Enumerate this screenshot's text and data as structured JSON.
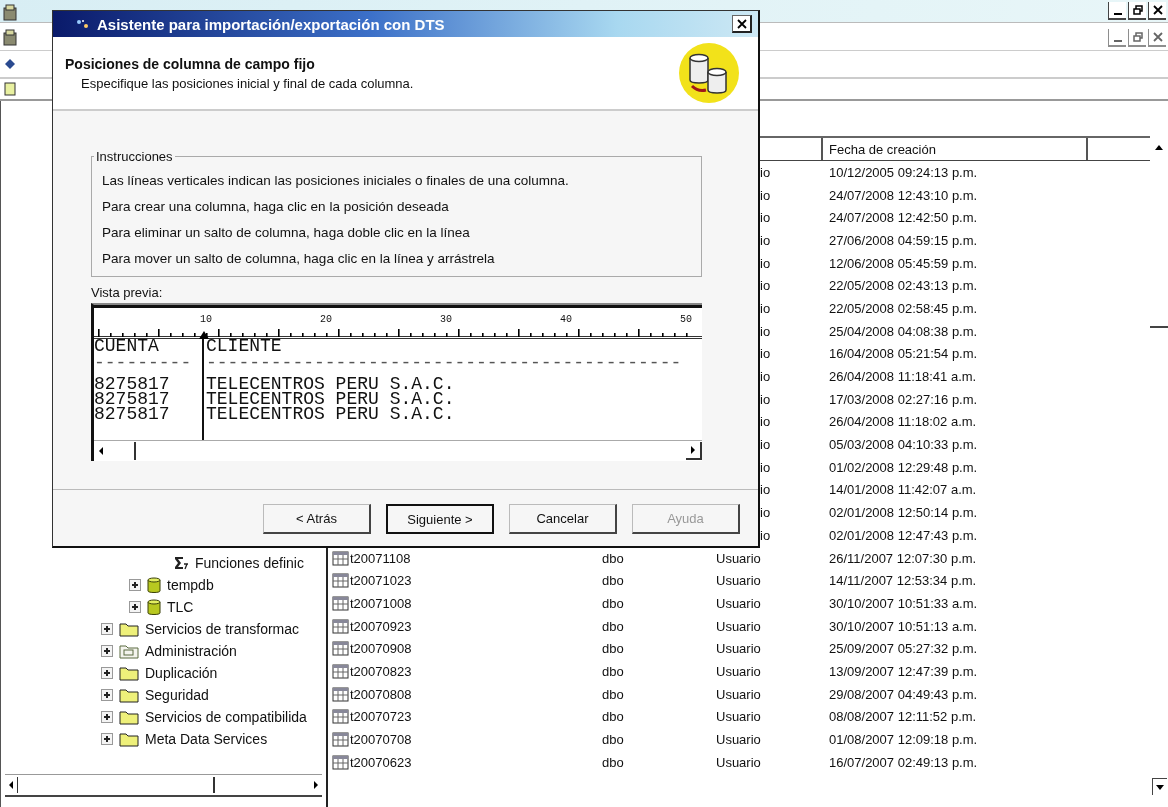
{
  "dialog": {
    "title": "Asistente para importación/exportación con DTS",
    "heading": "Posiciones de columna de campo fijo",
    "subheading": "Especifique las posiciones inicial y final de cada columna.",
    "instructions": {
      "legend": "Instrucciones",
      "lines": [
        "Las líneas verticales indican las posiciones iniciales o finales de una columna.",
        "Para crear una columna, haga clic en la posición deseada",
        "Para eliminar un salto de columna, haga doble clic en la línea",
        "Para mover un salto de columna, haga clic en la línea y arrástrela"
      ]
    },
    "preview": {
      "label": "Vista previa:",
      "ruler": [
        "10",
        "20",
        "30",
        "40",
        "50"
      ],
      "columns": [
        {
          "header": "CUENTA",
          "rule": "---------",
          "values": [
            "8275817",
            "8275817",
            "8275817"
          ]
        },
        {
          "header": "CLIENTE",
          "rule": "--------------------------------------------",
          "values": [
            "TELECENTROS PERU S.A.C.",
            "TELECENTROS PERU S.A.C.",
            "TELECENTROS PERU S.A.C."
          ]
        }
      ]
    },
    "buttons": [
      {
        "label": "< Atrás",
        "default": false,
        "disabled": false
      },
      {
        "label": "Siguiente >",
        "default": true,
        "disabled": false
      },
      {
        "label": "Cancelar",
        "default": false,
        "disabled": false
      },
      {
        "label": "Ayuda",
        "default": false,
        "disabled": true
      }
    ]
  },
  "tree": {
    "items": [
      {
        "children": [
          {
            "children": [
              {
                "label": "Funciones definic",
                "kind": "functions"
              }
            ]
          },
          {
            "label": "tempdb",
            "kind": "database",
            "expanded": false
          },
          {
            "label": "TLC",
            "kind": "database",
            "expanded": false
          }
        ]
      },
      {
        "label": "Servicios de transformac",
        "kind": "folder",
        "expanded": false
      },
      {
        "label": "Administración",
        "kind": "admin-folder",
        "expanded": false
      },
      {
        "label": "Duplicación",
        "kind": "folder",
        "expanded": false
      },
      {
        "label": "Seguridad",
        "kind": "folder",
        "expanded": false
      },
      {
        "label": "Servicios de compatibilida",
        "kind": "folder",
        "expanded": false
      },
      {
        "label": "Meta Data Services",
        "kind": "folder",
        "expanded": false
      }
    ]
  },
  "list": {
    "created_header": "Fecha de creación",
    "rows": [
      {
        "type": "io",
        "created": "10/12/2005 09:24:13 p.m."
      },
      {
        "type": "io",
        "created": "24/07/2008 12:43:10 p.m."
      },
      {
        "type": "io",
        "created": "24/07/2008 12:42:50 p.m."
      },
      {
        "type": "io",
        "created": "27/06/2008 04:59:15 p.m."
      },
      {
        "type": "io",
        "created": "12/06/2008 05:45:59 p.m."
      },
      {
        "type": "io",
        "created": "22/05/2008 02:43:13 p.m."
      },
      {
        "type": "io",
        "created": "22/05/2008 02:58:45 p.m."
      },
      {
        "type": "io",
        "created": "25/04/2008 04:08:38 p.m."
      },
      {
        "type": "io",
        "created": "16/04/2008 05:21:54 p.m."
      },
      {
        "type": "io",
        "created": "26/04/2008 11:18:41 a.m."
      },
      {
        "type": "io",
        "created": "17/03/2008 02:27:16 p.m."
      },
      {
        "type": "io",
        "created": "26/04/2008 11:18:02 a.m."
      },
      {
        "type": "io",
        "created": "05/03/2008 04:10:33 p.m."
      },
      {
        "type": "io",
        "created": "01/02/2008 12:29:48 p.m."
      },
      {
        "type": "io",
        "created": "14/01/2008 11:42:07 a.m."
      },
      {
        "type": "io",
        "created": "02/01/2008 12:50:14 p.m."
      },
      {
        "type": "io",
        "created": "02/01/2008 12:47:43 p.m."
      },
      {
        "name": "t20071108",
        "owner": "dbo",
        "type": "Usuario",
        "created": "26/11/2007 12:07:30 p.m."
      },
      {
        "name": "t20071023",
        "owner": "dbo",
        "type": "Usuario",
        "created": "14/11/2007 12:53:34 p.m."
      },
      {
        "name": "t20071008",
        "owner": "dbo",
        "type": "Usuario",
        "created": "30/10/2007 10:51:33 a.m."
      },
      {
        "name": "t20070923",
        "owner": "dbo",
        "type": "Usuario",
        "created": "30/10/2007 10:51:13 a.m."
      },
      {
        "name": "t20070908",
        "owner": "dbo",
        "type": "Usuario",
        "created": "25/09/2007 05:27:32 p.m."
      },
      {
        "name": "t20070823",
        "owner": "dbo",
        "type": "Usuario",
        "created": "13/09/2007 12:47:39 p.m."
      },
      {
        "name": "t20070808",
        "owner": "dbo",
        "type": "Usuario",
        "created": "29/08/2007 04:49:43 p.m."
      },
      {
        "name": "t20070723",
        "owner": "dbo",
        "type": "Usuario",
        "created": "08/08/2007 12:11:52 p.m."
      },
      {
        "name": "t20070708",
        "owner": "dbo",
        "type": "Usuario",
        "created": "01/08/2007 12:09:18 p.m."
      },
      {
        "name": "t20070623",
        "owner": "dbo",
        "type": "Usuario",
        "created": "16/07/2007 02:49:13 p.m."
      }
    ]
  }
}
